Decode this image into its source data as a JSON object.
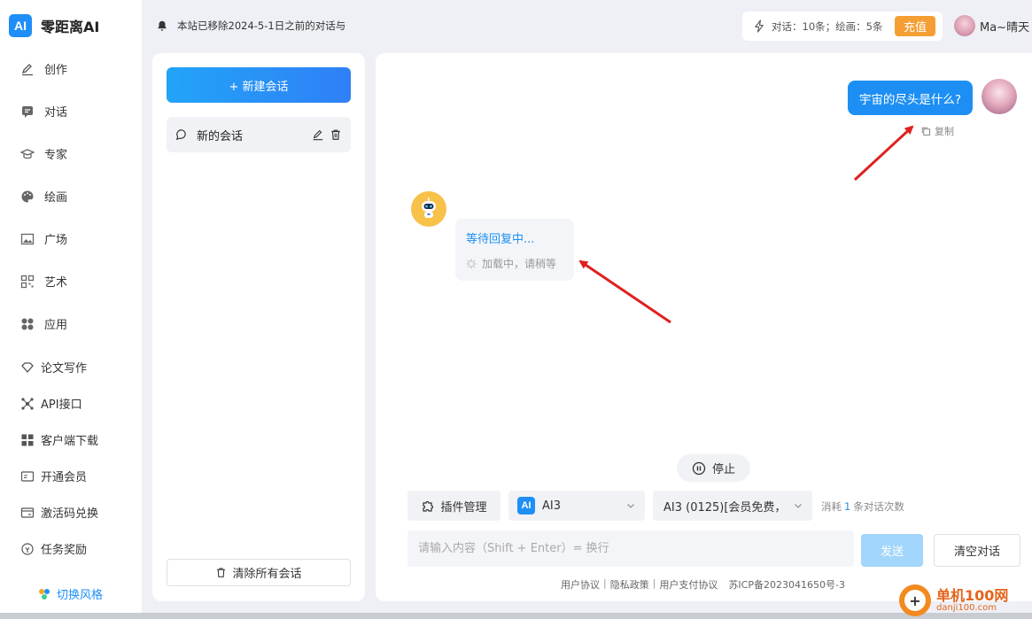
{
  "app": {
    "logo_badge": "AI",
    "name": "零距离AI"
  },
  "nav": {
    "items": [
      {
        "label": "创作",
        "icon": "pen-icon"
      },
      {
        "label": "对话",
        "icon": "chat-icon"
      },
      {
        "label": "专家",
        "icon": "graduation-cap-icon"
      },
      {
        "label": "绘画",
        "icon": "palette-icon"
      },
      {
        "label": "广场",
        "icon": "image-icon"
      },
      {
        "label": "艺术",
        "icon": "qrcode-icon"
      },
      {
        "label": "应用",
        "icon": "apps-icon"
      }
    ],
    "extra_items": [
      {
        "label": "论文写作",
        "icon": "diamond-icon"
      },
      {
        "label": "API接口",
        "icon": "api-icon"
      },
      {
        "label": "客户端下载",
        "icon": "grid-icon"
      },
      {
        "label": "开通会员",
        "icon": "vip-card-icon"
      },
      {
        "label": "激活码兑换",
        "icon": "wallet-icon"
      },
      {
        "label": "任务奖励",
        "icon": "reward-icon"
      }
    ],
    "theme_switch": "切换风格"
  },
  "topbar": {
    "notice": "本站已移除2024-5-1日之前的对话与",
    "quota": "对话：10条；绘画：5条",
    "recharge": "充值",
    "username": "Ma~晴天"
  },
  "conversations": {
    "new_button": "+ 新建会话",
    "items": [
      {
        "title": "新的会话"
      }
    ],
    "clear_all": "清除所有会话"
  },
  "chat": {
    "user_message": "宇宙的尽头是什么?",
    "copy_label": "复制",
    "bot_waiting": "等待回复中...",
    "bot_loading": "加载中，请稍等",
    "stop_label": "停止",
    "plugin_label": "插件管理",
    "model_badge": "AI",
    "model_select": "AI3",
    "model_variant": "AI3 (0125)[会员免费，",
    "consume_prefix": "消耗",
    "consume_count": "1",
    "consume_suffix": "条对话次数",
    "input_placeholder": "请输入内容（Shift + Enter）= 换行",
    "send_label": "发送",
    "clear_label": "清空对话"
  },
  "footer": {
    "links": [
      "用户协议",
      "隐私政策",
      "用户支付协议"
    ],
    "icp": "苏ICP备2023041650号-3"
  },
  "watermark": {
    "title": "单机100网",
    "url": "danji100.com"
  },
  "colors": {
    "accent": "#1d8ff4",
    "recharge": "#f59e33",
    "arrow": "#e02020"
  }
}
